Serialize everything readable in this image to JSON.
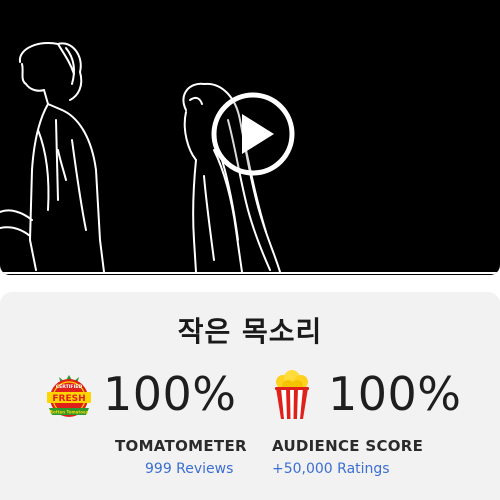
{
  "video": {
    "play_icon": "play-icon"
  },
  "title": "작은 목소리",
  "tomatometer": {
    "badge_icon": "certified-fresh-icon",
    "badge_text_top": "CERTIFIED",
    "badge_text_main": "FRESH",
    "badge_text_bottom": "Rotten Tomatoes",
    "score": "100%",
    "label": "TOMATOMETER",
    "count": "999 Reviews"
  },
  "audience": {
    "icon": "popcorn-icon",
    "score": "100%",
    "label": "AUDIENCE SCORE",
    "count": "+50,000 Ratings"
  },
  "colors": {
    "accent_link": "#3c6ed4",
    "card_background": "#f2f2f2",
    "fresh_red": "#e0201b",
    "fresh_green": "#2e9a2e"
  }
}
